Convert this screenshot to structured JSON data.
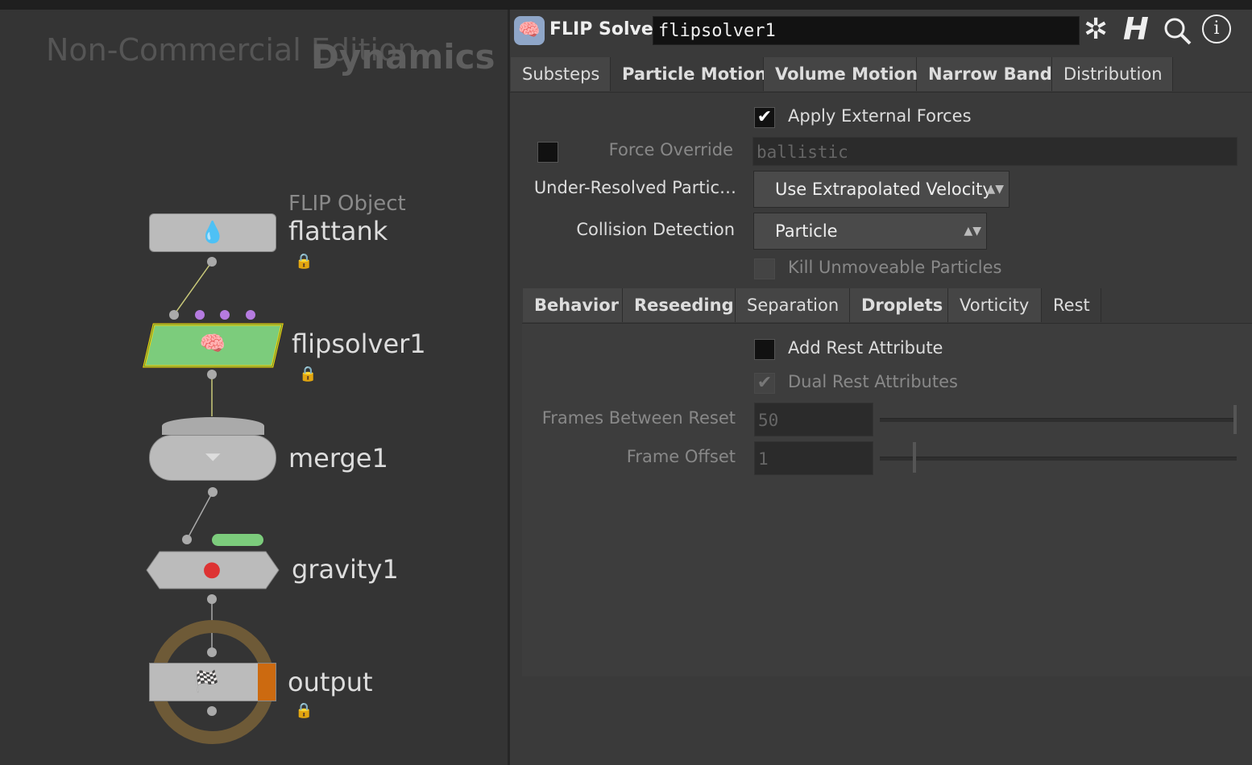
{
  "network": {
    "watermark": "Non-Commercial Edition",
    "context": "Dynamics",
    "nodes": [
      {
        "type": "FLIP Object",
        "name": "flattank",
        "icon": "water-drop-icon"
      },
      {
        "name": "flipsolver1",
        "icon": "brain-icon"
      },
      {
        "name": "merge1",
        "icon": "funnel-icon"
      },
      {
        "name": "gravity1",
        "icon": "apple-icon"
      },
      {
        "name": "output",
        "icon": "checkered-flag-icon"
      }
    ]
  },
  "params": {
    "node_type": "FLIP Solver",
    "node_name": "flipsolver1",
    "toolbar_icons": [
      "gear-icon",
      "houdini-help-icon",
      "search-icon",
      "info-icon"
    ],
    "tabs": [
      "Substeps",
      "Particle Motion",
      "Volume Motion",
      "Narrow Band",
      "Distribution"
    ],
    "apply_external_forces": "Apply External Forces",
    "force_override_label": "Force Override",
    "force_override_value": "ballistic",
    "under_resolved_label": "Under-Resolved Partic…",
    "under_resolved_value": "Use Extrapolated Velocity",
    "collision_label": "Collision Detection",
    "collision_value": "Particle",
    "kill_unmoveable": "Kill Unmoveable Particles",
    "subtabs": [
      "Behavior",
      "Reseeding",
      "Separation",
      "Droplets",
      "Vorticity",
      "Rest"
    ],
    "add_rest": "Add Rest Attribute",
    "dual_rest": "Dual Rest Attributes",
    "frames_between_label": "Frames Between Reset",
    "frames_between_value": "50",
    "frame_offset_label": "Frame Offset",
    "frame_offset_value": "1"
  }
}
